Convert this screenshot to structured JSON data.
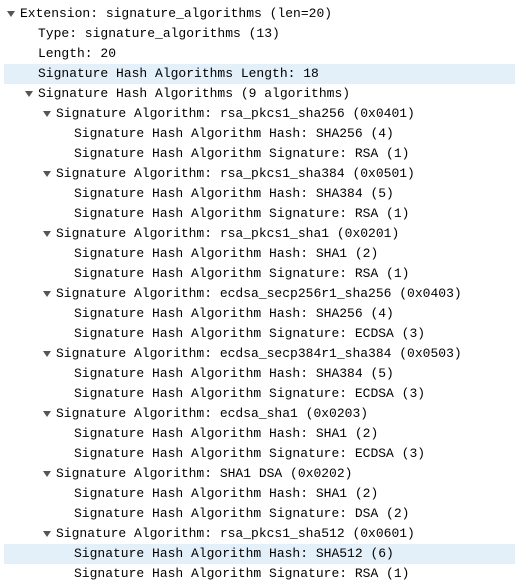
{
  "header": {
    "title": "Extension: signature_algorithms (len=20)",
    "type": "Type: signature_algorithms (13)",
    "length": "Length: 20",
    "sha_length": "Signature Hash Algorithms Length: 18",
    "algs_header": "Signature Hash Algorithms (9 algorithms)"
  },
  "algorithms": [
    {
      "title": "Signature Algorithm: rsa_pkcs1_sha256 (0x0401)",
      "hash": "Signature Hash Algorithm Hash: SHA256 (4)",
      "sig": "Signature Hash Algorithm Signature: RSA (1)"
    },
    {
      "title": "Signature Algorithm: rsa_pkcs1_sha384 (0x0501)",
      "hash": "Signature Hash Algorithm Hash: SHA384 (5)",
      "sig": "Signature Hash Algorithm Signature: RSA (1)"
    },
    {
      "title": "Signature Algorithm: rsa_pkcs1_sha1 (0x0201)",
      "hash": "Signature Hash Algorithm Hash: SHA1 (2)",
      "sig": "Signature Hash Algorithm Signature: RSA (1)"
    },
    {
      "title": "Signature Algorithm: ecdsa_secp256r1_sha256 (0x0403)",
      "hash": "Signature Hash Algorithm Hash: SHA256 (4)",
      "sig": "Signature Hash Algorithm Signature: ECDSA (3)"
    },
    {
      "title": "Signature Algorithm: ecdsa_secp384r1_sha384 (0x0503)",
      "hash": "Signature Hash Algorithm Hash: SHA384 (5)",
      "sig": "Signature Hash Algorithm Signature: ECDSA (3)"
    },
    {
      "title": "Signature Algorithm: ecdsa_sha1 (0x0203)",
      "hash": "Signature Hash Algorithm Hash: SHA1 (2)",
      "sig": "Signature Hash Algorithm Signature: ECDSA (3)"
    },
    {
      "title": "Signature Algorithm: SHA1 DSA (0x0202)",
      "hash": "Signature Hash Algorithm Hash: SHA1 (2)",
      "sig": "Signature Hash Algorithm Signature: DSA (2)"
    },
    {
      "title": "Signature Algorithm: rsa_pkcs1_sha512 (0x0601)",
      "hash": "Signature Hash Algorithm Hash: SHA512 (6)",
      "sig": "Signature Hash Algorithm Signature: RSA (1)"
    }
  ],
  "highlight_hash_index": 7
}
